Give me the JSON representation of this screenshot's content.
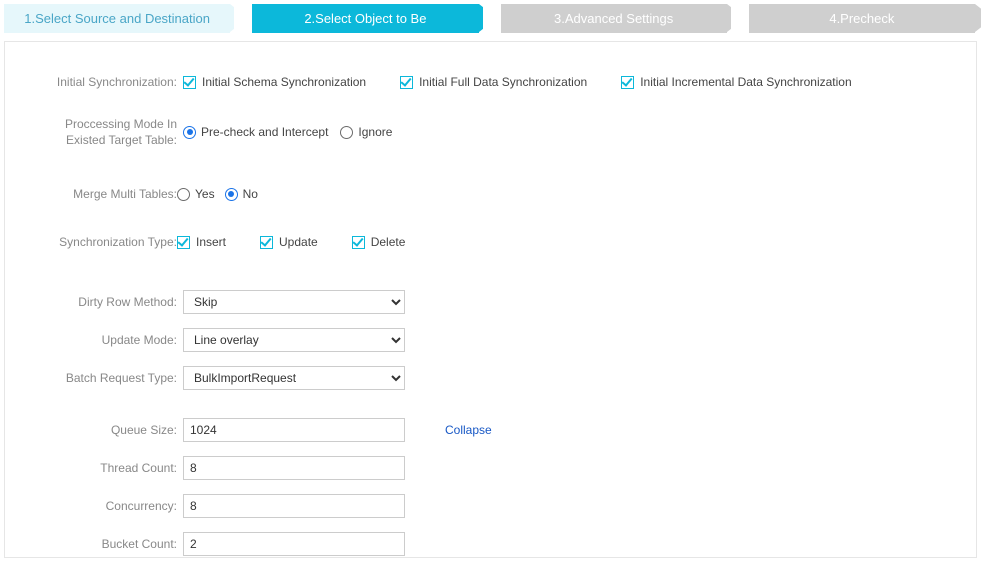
{
  "steps": [
    {
      "label": "1.Select Source and Destination",
      "state": "done"
    },
    {
      "label": "2.Select Object to Be",
      "state": "active"
    },
    {
      "label": "3.Advanced Settings",
      "state": "todo"
    },
    {
      "label": "4.Precheck",
      "state": "todo"
    }
  ],
  "initial_sync": {
    "label": "Initial Synchronization:",
    "schema": {
      "label": "Initial Schema Synchronization",
      "checked": true
    },
    "full": {
      "label": "Initial Full Data Synchronization",
      "checked": true
    },
    "increment": {
      "label": "Initial Incremental Data Synchronization",
      "checked": true
    }
  },
  "processing_mode": {
    "label_line1": "Proccessing Mode In",
    "label_line2": "Existed Target Table:",
    "precheck": {
      "label": "Pre-check and Intercept",
      "selected": true
    },
    "ignore": {
      "label": "Ignore",
      "selected": false
    }
  },
  "merge_tables": {
    "label": "Merge Multi Tables:",
    "yes": {
      "label": "Yes",
      "selected": false
    },
    "no": {
      "label": "No",
      "selected": true
    }
  },
  "sync_type": {
    "label": "Synchronization Type:",
    "insert": {
      "label": "Insert",
      "checked": true
    },
    "update": {
      "label": "Update",
      "checked": true
    },
    "delete": {
      "label": "Delete",
      "checked": true
    }
  },
  "dirty_row": {
    "label": "Dirty Row Method:",
    "value": "Skip"
  },
  "update_mode": {
    "label": "Update Mode:",
    "value": "Line overlay"
  },
  "batch_req": {
    "label": "Batch Request Type:",
    "value": "BulkImportRequest"
  },
  "collapse_link": "Collapse",
  "queue_size": {
    "label": "Queue Size:",
    "value": "1024"
  },
  "thread_count": {
    "label": "Thread Count:",
    "value": "8"
  },
  "concurrency": {
    "label": "Concurrency:",
    "value": "8"
  },
  "bucket_count": {
    "label": "Bucket Count:",
    "value": "2"
  }
}
